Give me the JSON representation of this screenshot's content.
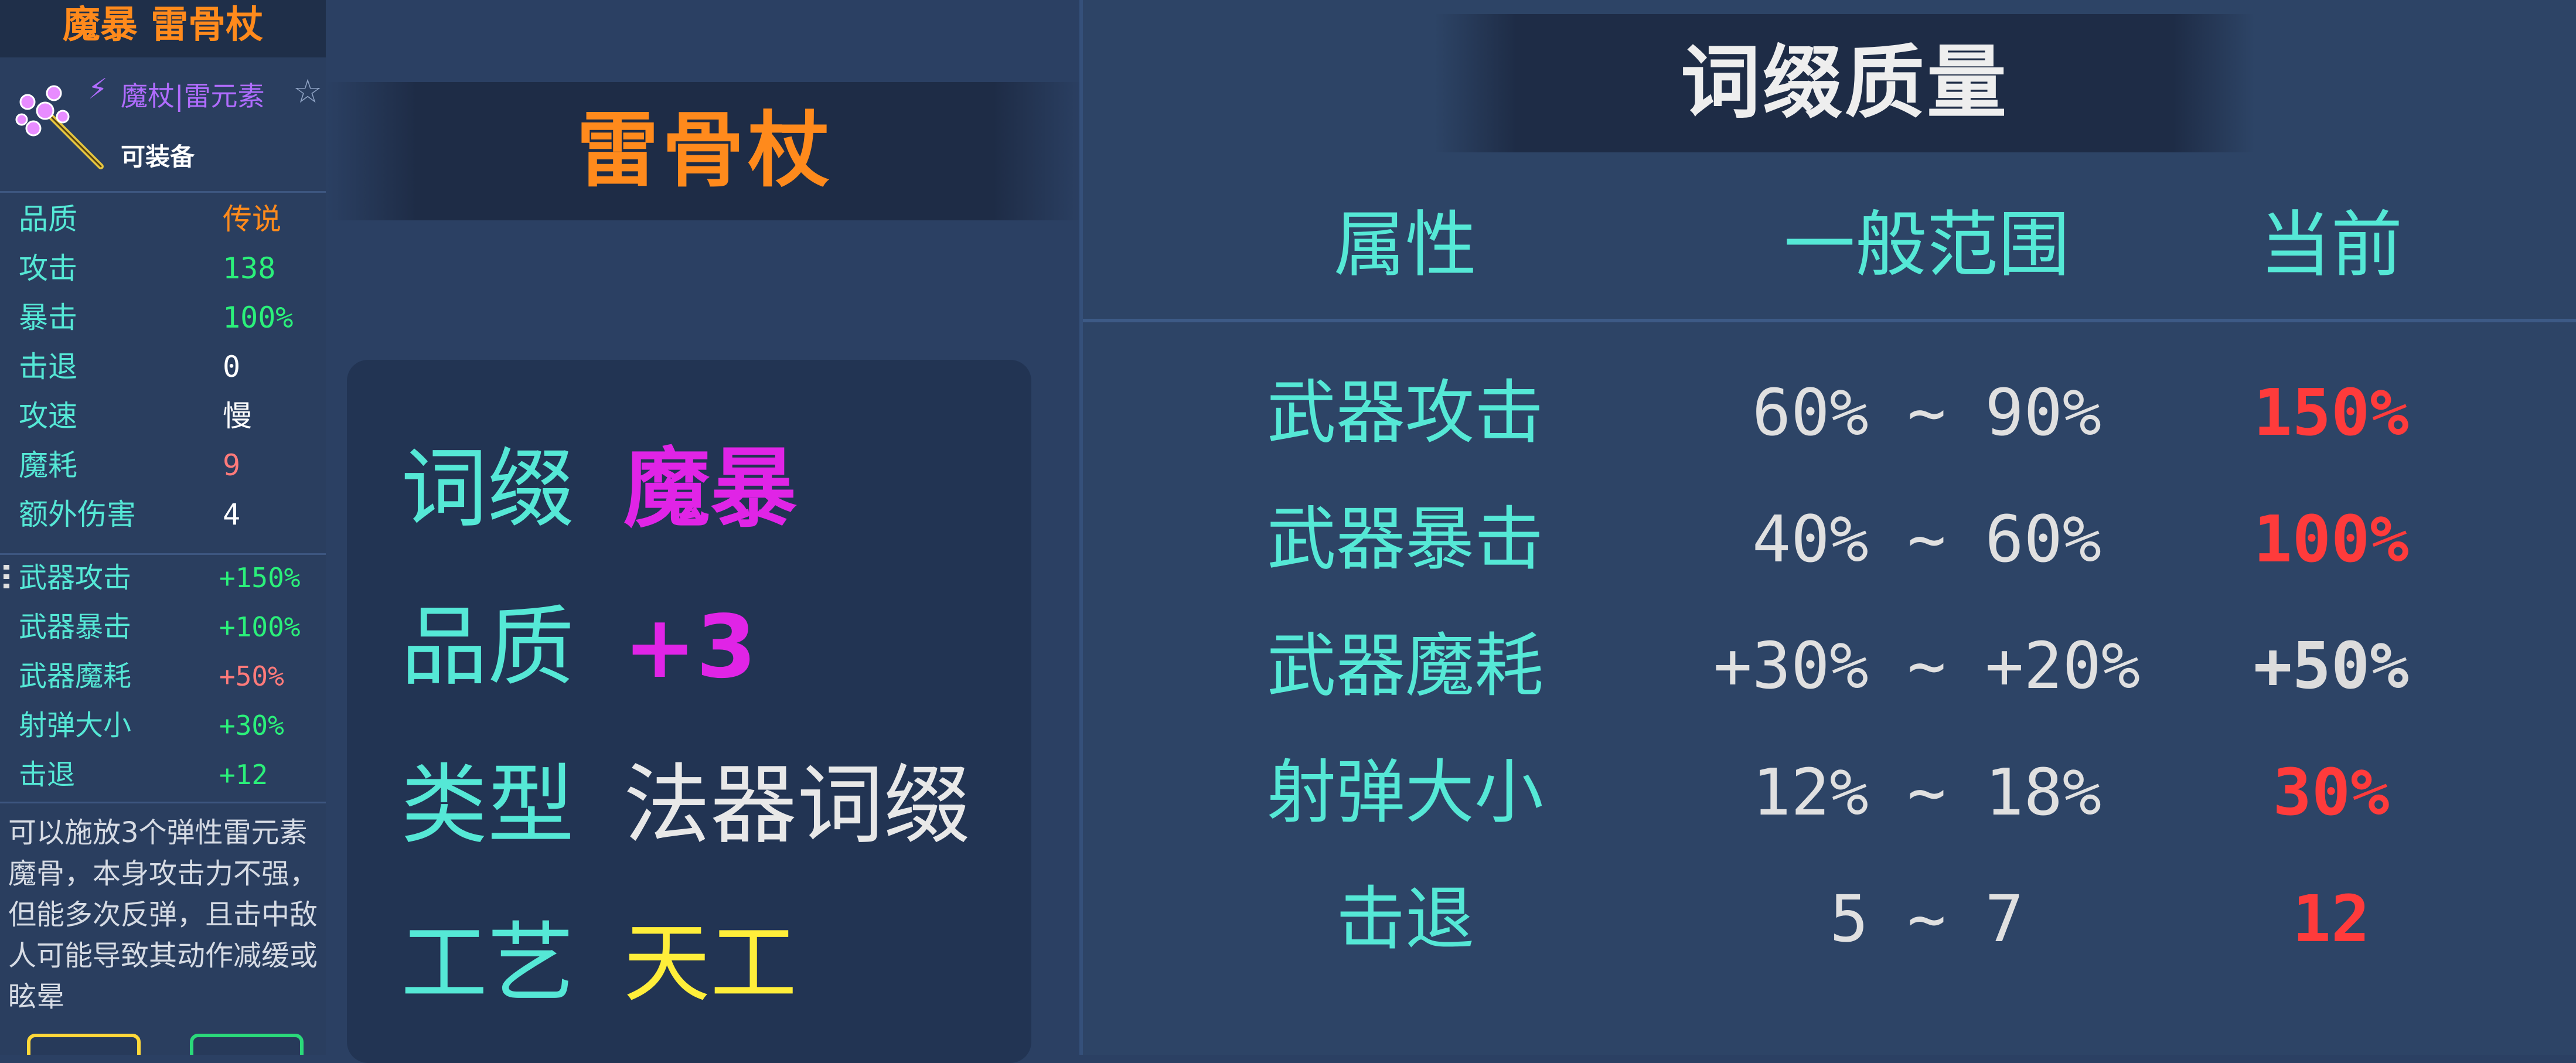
{
  "item_panel": {
    "title": "魔暴 雷骨杖",
    "type_label": "魔杖|雷元素",
    "equippable": "可装备",
    "stats": [
      {
        "label": "品质",
        "value": "传说",
        "color": "#ff8a1c"
      },
      {
        "label": "攻击",
        "value": "138",
        "color": "#2bf07a"
      },
      {
        "label": "暴击",
        "value": "100%",
        "color": "#2bf07a"
      },
      {
        "label": "击退",
        "value": "0",
        "color": "#ffffff"
      },
      {
        "label": "攻速",
        "value": "慢",
        "color": "#ffffff"
      },
      {
        "label": "魔耗",
        "value": "9",
        "color": "#ff7a7a"
      },
      {
        "label": "额外伤害",
        "value": "4",
        "color": "#ffffff"
      }
    ],
    "affixes": [
      {
        "label": "武器攻击",
        "value": "+150%",
        "color": "#2bf07a"
      },
      {
        "label": "武器暴击",
        "value": "+100%",
        "color": "#2bf07a"
      },
      {
        "label": "武器魔耗",
        "value": "+50%",
        "color": "#ff7a7a"
      },
      {
        "label": "射弹大小",
        "value": "+30%",
        "color": "#2bf07a"
      },
      {
        "label": "击退",
        "value": "+12",
        "color": "#2bf07a"
      }
    ],
    "description": "可以施放3个弹性雷元素魔骨，本身攻击力不强，但能多次反弹，且击中敌人可能导致其动作减缓或眩晕",
    "icons": {
      "wand": "wand-icon",
      "element": "lightning-icon",
      "favorite": "star-icon"
    }
  },
  "weapon_info": {
    "name": "雷骨杖",
    "rows": [
      {
        "key": "词缀",
        "value": "魔暴",
        "style": "val-magenta"
      },
      {
        "key": "品质",
        "value": "+3",
        "style": "val-magenta"
      },
      {
        "key": "类型",
        "value": "法器词缀",
        "style": "val-white"
      },
      {
        "key": "工艺",
        "value": "天工",
        "style": "val-yellow"
      }
    ]
  },
  "quality_table": {
    "title": "词缀质量",
    "headers": {
      "attr": "属性",
      "range": "一般范围",
      "current": "当前"
    },
    "rows": [
      {
        "attr": "武器攻击",
        "range": "60% ~ 90%",
        "current": "150%",
        "color": "#ff3b3b"
      },
      {
        "attr": "武器暴击",
        "range": "40% ~ 60%",
        "current": "100%",
        "color": "#ff3b3b"
      },
      {
        "attr": "武器魔耗",
        "range": "+30% ~ +20%",
        "current": "+50%",
        "color": "#dcdcdc"
      },
      {
        "attr": "射弹大小",
        "range": "12% ~ 18%",
        "current": "30%",
        "color": "#ff3b3b"
      },
      {
        "attr": "击退",
        "range": "5 ~ 7",
        "current": "12",
        "color": "#ff3b3b"
      }
    ]
  },
  "colors": {
    "label_cyan": "#55e8d6",
    "legendary_orange": "#ff8a1c",
    "affix_magenta": "#e024e6",
    "craft_yellow": "#ffee3a"
  }
}
